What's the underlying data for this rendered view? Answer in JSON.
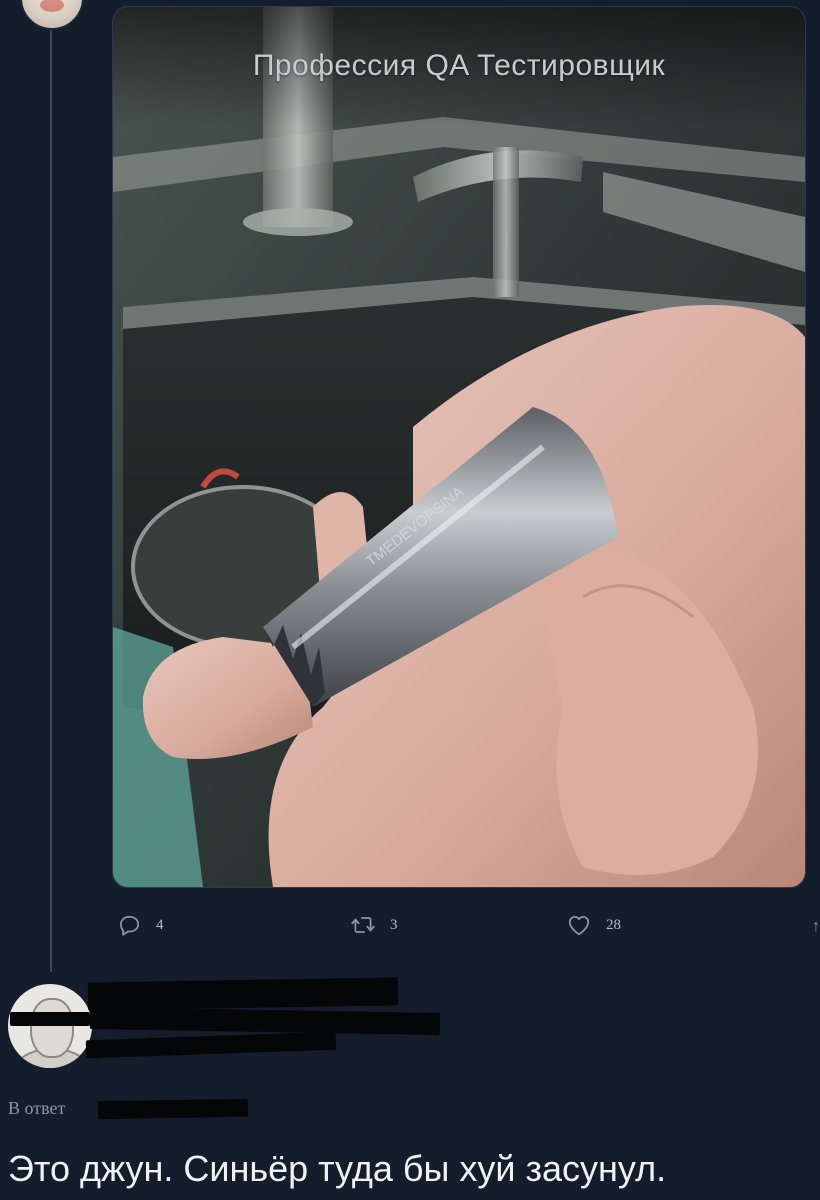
{
  "tweet": {
    "media": {
      "caption": "Профессия QA Тестировщик",
      "engraving": "TMEDEVOPSINA",
      "alt_subject": "photo-hand-with-metal-nozzle"
    },
    "actions": {
      "reply_count": "4",
      "retweet_count": "3",
      "like_count": "28"
    }
  },
  "reply": {
    "in_reply_to_label": "В ответ",
    "text": "Это джун. Синьёр туда бы хуй засунул."
  },
  "icons": {
    "reply": "reply-icon",
    "retweet": "retweet-icon",
    "like": "heart-icon",
    "share": "share-icon"
  },
  "colors": {
    "background": "#141d2b",
    "thread_line": "#3b4654",
    "icon": "#8b98a5",
    "text_primary": "#f0f2f4",
    "text_secondary": "#8b98a5"
  }
}
